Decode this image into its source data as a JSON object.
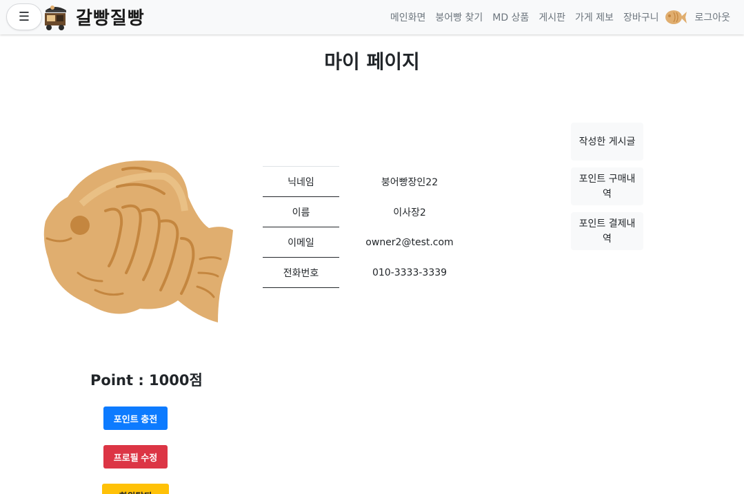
{
  "navbar": {
    "menu_icon": "☰",
    "brand": "갈빵질빵",
    "links": [
      "메인화면",
      "붕어빵 찾기",
      "MD 상품",
      "게시판",
      "가게 제보",
      "장바구니"
    ],
    "logout": "로그아웃"
  },
  "page": {
    "title": "마이 페이지"
  },
  "profile": {
    "fields": [
      {
        "label": "닉네임",
        "value": "붕어빵장인22"
      },
      {
        "label": "이름",
        "value": "이사장2"
      },
      {
        "label": "이메일",
        "value": "owner2@test.com"
      },
      {
        "label": "전화번호",
        "value": "010-3333-3339"
      }
    ],
    "point_text": "Point : 1000점"
  },
  "side_menu": [
    "작성한 게시글",
    "포인트 구매내역",
    "포인트 결제내역"
  ],
  "buttons": {
    "charge": "포인트 충전",
    "edit": "프로필 수정",
    "third": "회원탈퇴"
  },
  "colors": {
    "primary": "#0d7bff",
    "danger": "#dc3545",
    "warning": "#ffc107",
    "fish": "#e0ae6f",
    "fish_line": "#c4863f"
  }
}
